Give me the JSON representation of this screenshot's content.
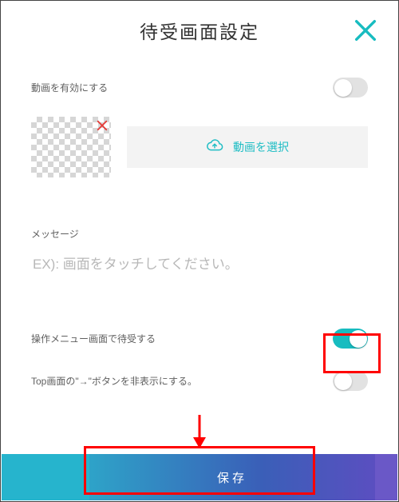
{
  "header": {
    "title": "待受画面設定"
  },
  "rows": {
    "enable_video_label": "動画を有効にする",
    "enable_video_on": false,
    "select_video_label": "動画を選択",
    "message_label": "メッセージ",
    "message_placeholder": "EX): 画面をタッチしてください。",
    "message_value": "",
    "wait_on_menu_label": "操作メニュー画面で待受する",
    "wait_on_menu_on": true,
    "hide_top_arrow_label": "Top画面の\"→\"ボタンを非表示にする。",
    "hide_top_arrow_on": false
  },
  "footer": {
    "save_label": "保存"
  },
  "colors": {
    "accent": "#17bcc0",
    "highlight": "#ff0000"
  },
  "icons": {
    "close": "close-icon",
    "remove": "remove-icon",
    "cloud_upload": "cloud-upload-icon",
    "arrow_down": "arrow-down-icon"
  }
}
